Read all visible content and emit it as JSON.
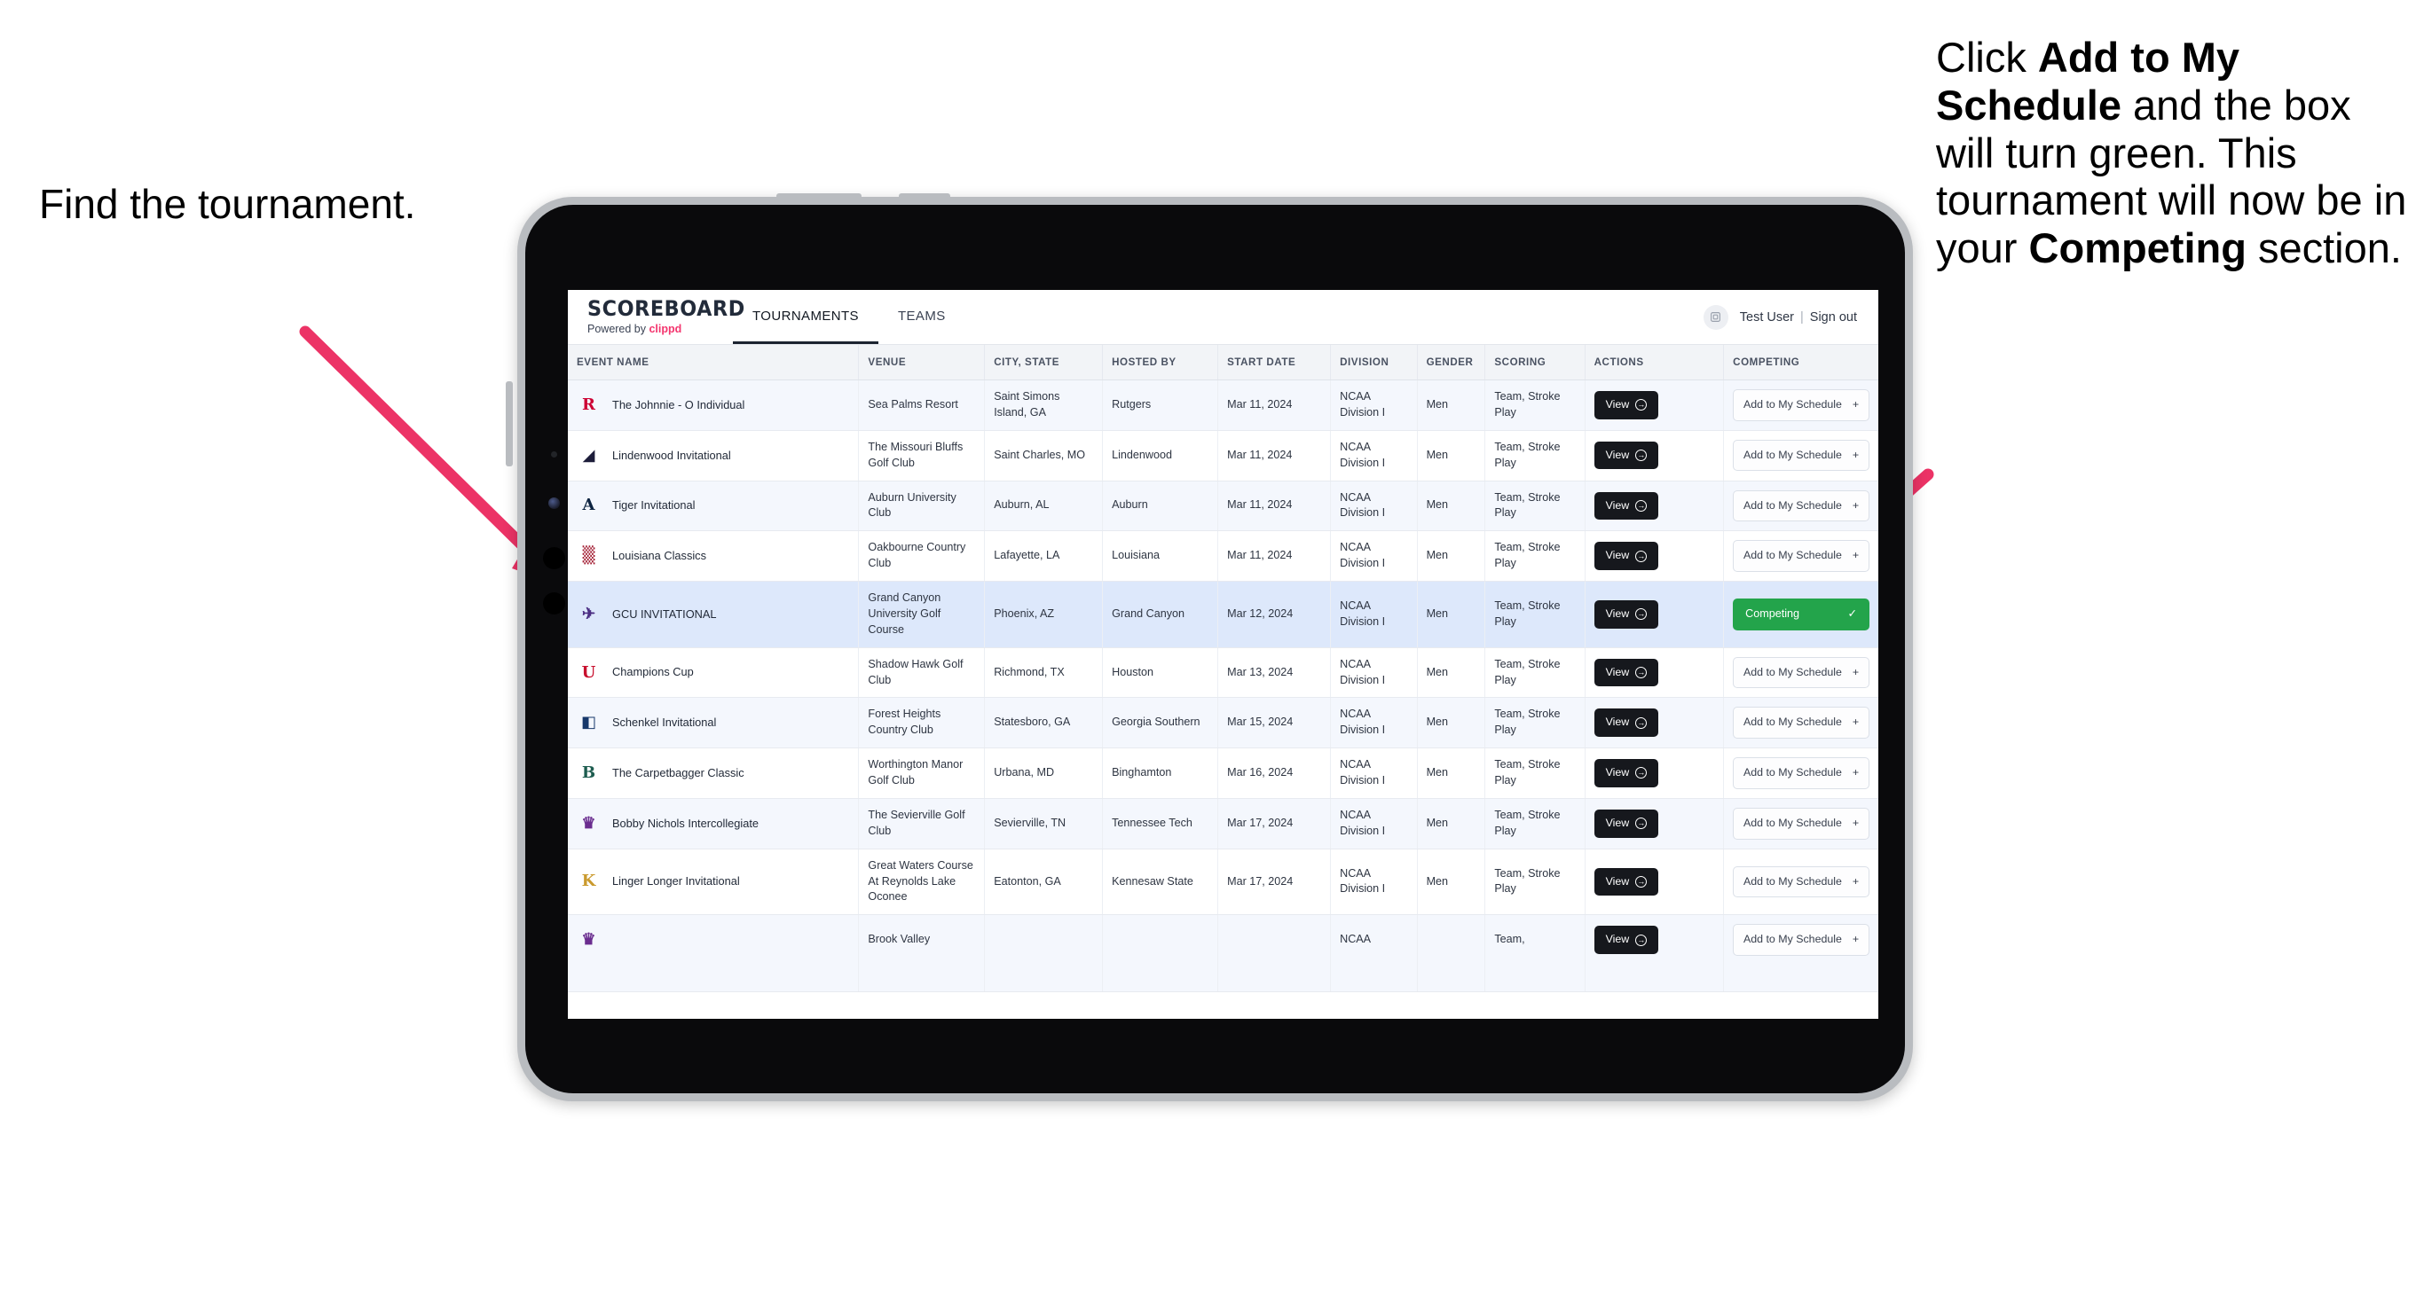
{
  "annotations": {
    "left": "Find the tournament.",
    "right_parts": [
      {
        "t": "Click ",
        "b": false
      },
      {
        "t": "Add to My Schedule",
        "b": true
      },
      {
        "t": " and the box will turn green. This tournament will now be in your ",
        "b": false
      },
      {
        "t": "Competing",
        "b": true
      },
      {
        "t": " section.",
        "b": false
      }
    ],
    "arrow_color": "#ec3366"
  },
  "app": {
    "brand": {
      "title": "SCOREBOARD",
      "powered_prefix": "Powered by ",
      "powered_brand": "clippd"
    },
    "nav": [
      {
        "label": "TOURNAMENTS",
        "active": true
      },
      {
        "label": "TEAMS",
        "active": false
      }
    ],
    "user": {
      "name": "Test User",
      "separator": "|",
      "sign_out": "Sign out",
      "avatar_icon": "user-avatar-icon"
    },
    "table": {
      "headers": [
        "EVENT NAME",
        "VENUE",
        "CITY, STATE",
        "HOSTED BY",
        "START DATE",
        "DIVISION",
        "GENDER",
        "SCORING",
        "ACTIONS",
        "COMPETING"
      ],
      "view_label": "View",
      "add_label": "Add to My Schedule",
      "add_icon": "plus-icon",
      "competing_label": "Competing",
      "competing_icon": "check-icon",
      "competing_color": "#23a44b",
      "rows": [
        {
          "event": "The Johnnie - O Individual",
          "venue": "Sea Palms Resort",
          "city": "Saint Simons Island, GA",
          "host": "Rutgers",
          "date": "Mar 11, 2024",
          "division": "NCAA Division I",
          "gender": "Men",
          "scoring": "Team, Stroke Play",
          "competing": false,
          "logo_text": "R",
          "logo_fg": "#cc0033",
          "logo_bg": "transparent"
        },
        {
          "event": "Lindenwood Invitational",
          "venue": "The Missouri Bluffs Golf Club",
          "city": "Saint Charles, MO",
          "host": "Lindenwood",
          "date": "Mar 11, 2024",
          "division": "NCAA Division I",
          "gender": "Men",
          "scoring": "Team, Stroke Play",
          "competing": false,
          "logo_text": "◢",
          "logo_fg": "#1d1d3a",
          "logo_bg": "transparent"
        },
        {
          "event": "Tiger Invitational",
          "venue": "Auburn University Club",
          "city": "Auburn, AL",
          "host": "Auburn",
          "date": "Mar 11, 2024",
          "division": "NCAA Division I",
          "gender": "Men",
          "scoring": "Team, Stroke Play",
          "competing": false,
          "logo_text": "A",
          "logo_fg": "#0c2340",
          "logo_bg": "transparent"
        },
        {
          "event": "Louisiana Classics",
          "venue": "Oakbourne Country Club",
          "city": "Lafayette, LA",
          "host": "Louisiana",
          "date": "Mar 11, 2024",
          "division": "NCAA Division I",
          "gender": "Men",
          "scoring": "Team, Stroke Play",
          "competing": false,
          "logo_text": "▒",
          "logo_fg": "#a31f34",
          "logo_bg": "transparent"
        },
        {
          "event": "GCU INVITATIONAL",
          "venue": "Grand Canyon University Golf Course",
          "city": "Phoenix, AZ",
          "host": "Grand Canyon",
          "date": "Mar 12, 2024",
          "division": "NCAA Division I",
          "gender": "Men",
          "scoring": "Team, Stroke Play",
          "competing": true,
          "logo_text": "✈",
          "logo_fg": "#4b2e83",
          "logo_bg": "transparent"
        },
        {
          "event": "Champions Cup",
          "venue": "Shadow Hawk Golf Club",
          "city": "Richmond, TX",
          "host": "Houston",
          "date": "Mar 13, 2024",
          "division": "NCAA Division I",
          "gender": "Men",
          "scoring": "Team, Stroke Play",
          "competing": false,
          "logo_text": "U",
          "logo_fg": "#c8102e",
          "logo_bg": "transparent"
        },
        {
          "event": "Schenkel Invitational",
          "venue": "Forest Heights Country Club",
          "city": "Statesboro, GA",
          "host": "Georgia Southern",
          "date": "Mar 15, 2024",
          "division": "NCAA Division I",
          "gender": "Men",
          "scoring": "Team, Stroke Play",
          "competing": false,
          "logo_text": "◧",
          "logo_fg": "#17386b",
          "logo_bg": "transparent"
        },
        {
          "event": "The Carpetbagger Classic",
          "venue": "Worthington Manor Golf Club",
          "city": "Urbana, MD",
          "host": "Binghamton",
          "date": "Mar 16, 2024",
          "division": "NCAA Division I",
          "gender": "Men",
          "scoring": "Team, Stroke Play",
          "competing": false,
          "logo_text": "B",
          "logo_fg": "#1d5c4f",
          "logo_bg": "transparent"
        },
        {
          "event": "Bobby Nichols Intercollegiate",
          "venue": "The Sevierville Golf Club",
          "city": "Sevierville, TN",
          "host": "Tennessee Tech",
          "date": "Mar 17, 2024",
          "division": "NCAA Division I",
          "gender": "Men",
          "scoring": "Team, Stroke Play",
          "competing": false,
          "logo_text": "♛",
          "logo_fg": "#6a2d8f",
          "logo_bg": "transparent"
        },
        {
          "event": "Linger Longer Invitational",
          "venue": "Great Waters Course At Reynolds Lake Oconee",
          "city": "Eatonton, GA",
          "host": "Kennesaw State",
          "date": "Mar 17, 2024",
          "division": "NCAA Division I",
          "gender": "Men",
          "scoring": "Team, Stroke Play",
          "competing": false,
          "logo_text": "K",
          "logo_fg": "#ca9a2e",
          "logo_bg": "transparent"
        },
        {
          "event": "",
          "venue": "Brook Valley",
          "city": "",
          "host": "",
          "date": "",
          "division": "NCAA",
          "gender": "",
          "scoring": "Team,",
          "competing": false,
          "logo_text": "♛",
          "logo_fg": "#6a2d8f",
          "logo_bg": "transparent"
        }
      ]
    }
  }
}
